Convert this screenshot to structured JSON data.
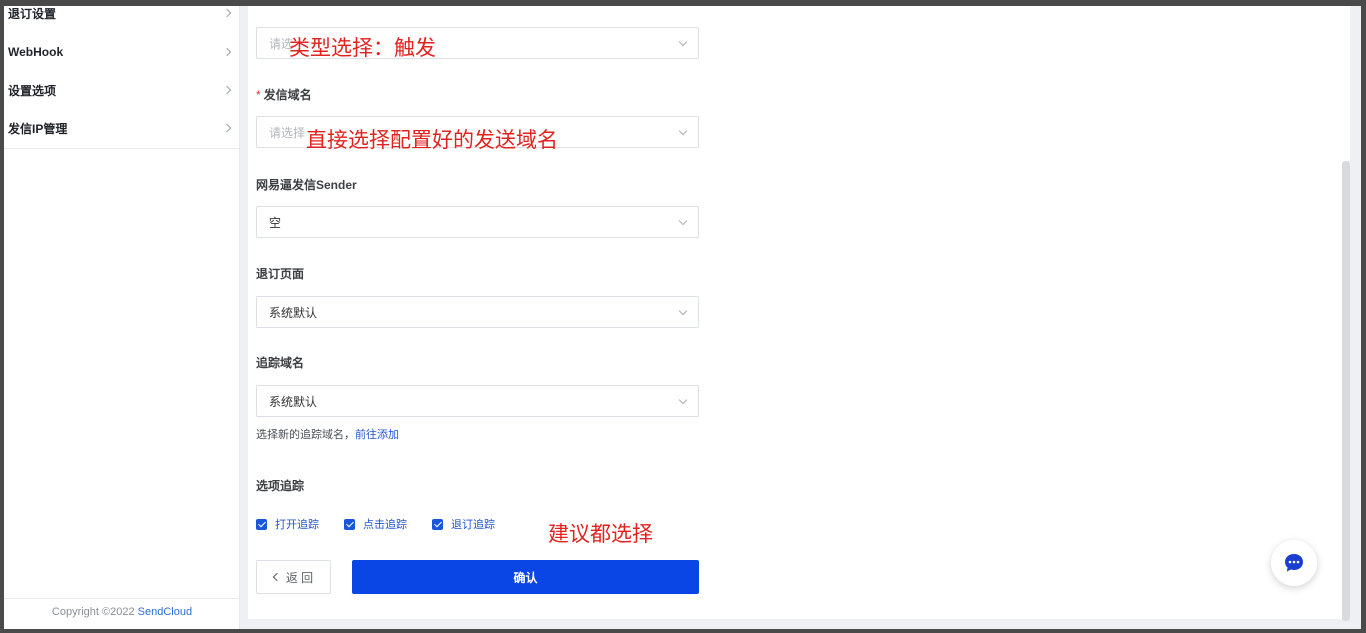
{
  "sidebar": {
    "items": [
      {
        "label": "退订设置"
      },
      {
        "label": "WebHook"
      },
      {
        "label": "设置选项"
      },
      {
        "label": "发信IP管理"
      }
    ],
    "copyright_prefix": "Copyright ©2022 ",
    "copyright_brand": "SendCloud"
  },
  "form": {
    "type_select": {
      "placeholder": "请选"
    },
    "send_domain": {
      "required_mark": "*",
      "label": "发信域名",
      "placeholder": "请选择"
    },
    "sender": {
      "label": "网易逼发信Sender",
      "value": "空"
    },
    "unsubscribe_page": {
      "label": "退订页面",
      "value": "系统默认"
    },
    "tracking_domain": {
      "label": "追踪域名",
      "value": "系统默认",
      "hint": "选择新的追踪域名，",
      "hint_link": "前往添加"
    },
    "tracking_options": {
      "label": "选项追踪",
      "items": [
        {
          "label": "打开追踪",
          "checked": true
        },
        {
          "label": "点击追踪",
          "checked": true
        },
        {
          "label": "退订追踪",
          "checked": true
        }
      ]
    },
    "back_label": "返 回",
    "confirm_label": "确认"
  },
  "annotations": {
    "type_note": "类型选择：触发",
    "domain_note": "直接选择配置好的发送域名",
    "tracking_note": "建议都选择"
  },
  "colors": {
    "primary": "#0a45e6",
    "link": "#2255d4",
    "annotation": "#e0231f"
  },
  "icons": [
    "chevron-right-icon",
    "chevron-down-icon",
    "chevron-left-icon",
    "checkbox-checked-icon",
    "chat-bubble-icon"
  ]
}
